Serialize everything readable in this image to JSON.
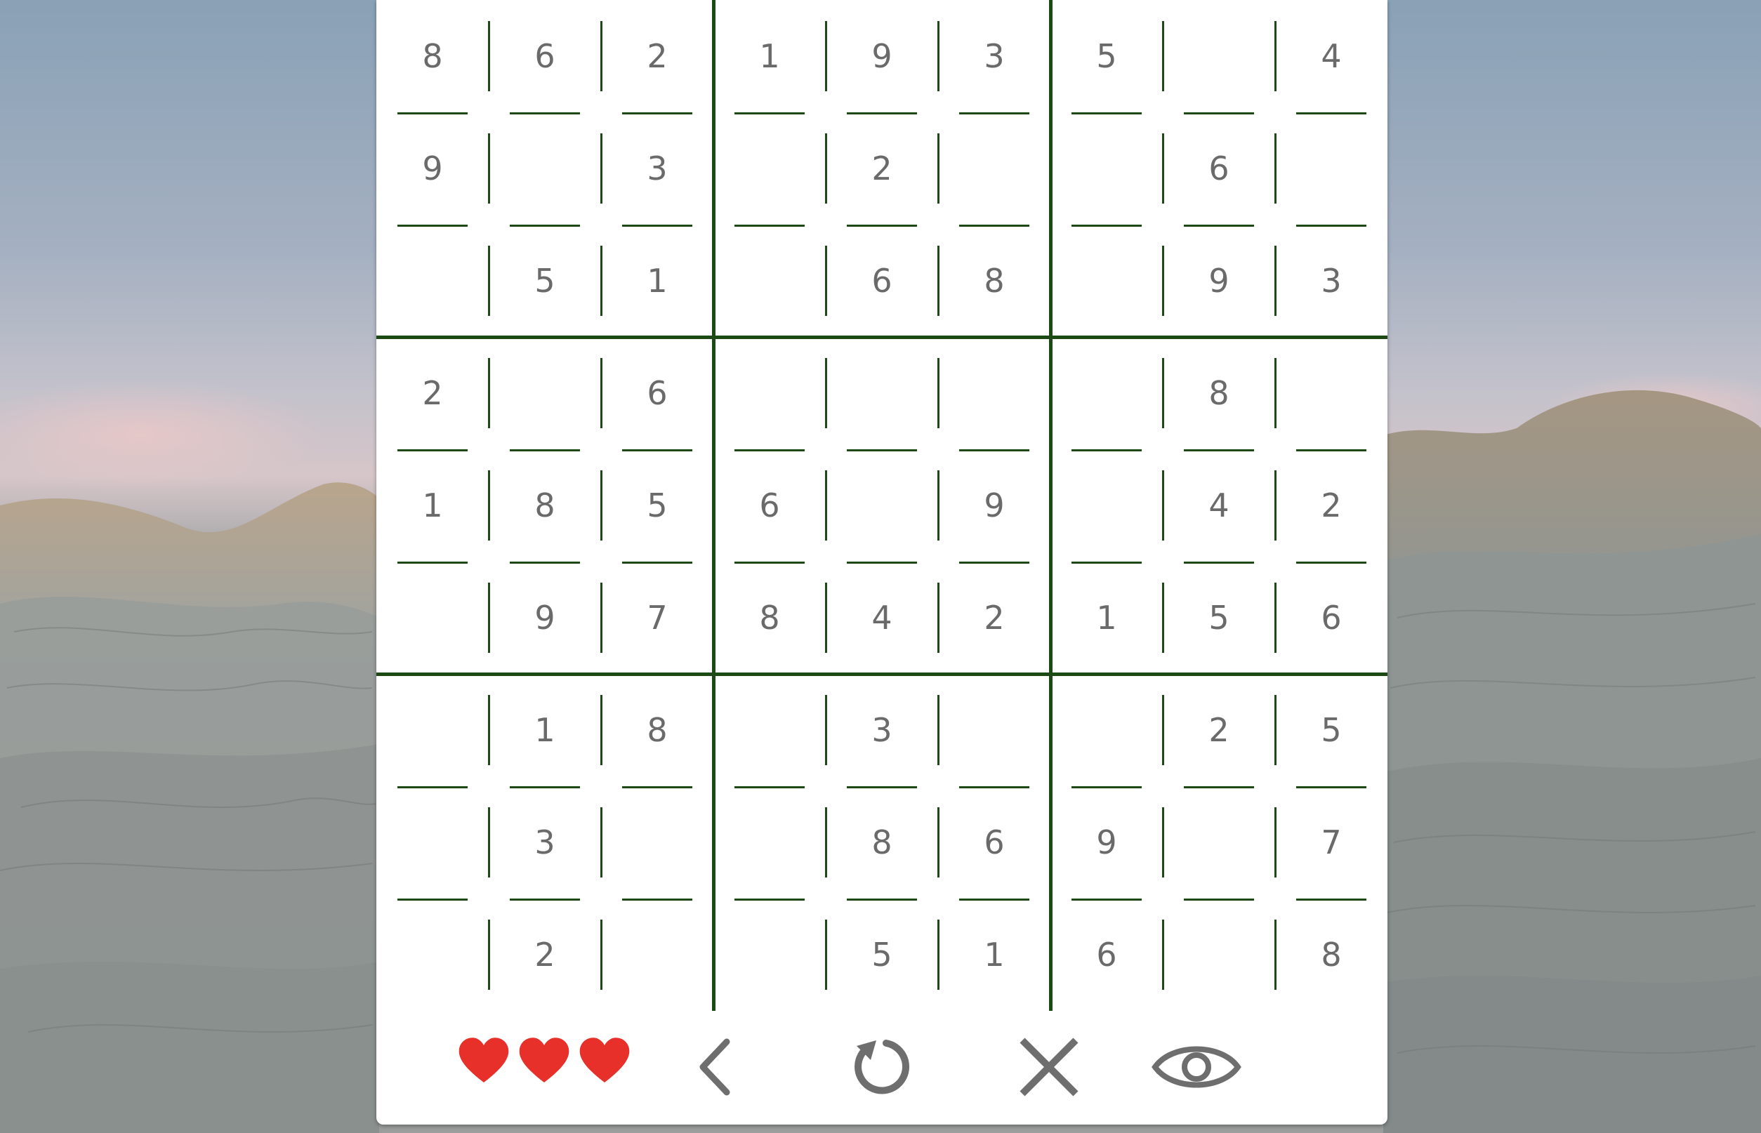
{
  "board": {
    "rows": [
      [
        "8",
        "6",
        "2",
        "1",
        "9",
        "3",
        "5",
        "",
        "4"
      ],
      [
        "9",
        "",
        "3",
        "",
        "2",
        "",
        "",
        "6",
        ""
      ],
      [
        "",
        "5",
        "1",
        "",
        "6",
        "8",
        "",
        "9",
        "3"
      ],
      [
        "2",
        "",
        "6",
        "",
        "",
        "",
        "",
        "8",
        ""
      ],
      [
        "1",
        "8",
        "5",
        "6",
        "",
        "9",
        "",
        "4",
        "2"
      ],
      [
        "",
        "9",
        "7",
        "8",
        "4",
        "2",
        "1",
        "5",
        "6"
      ],
      [
        "",
        "1",
        "8",
        "",
        "3",
        "",
        "",
        "2",
        "5"
      ],
      [
        "",
        "3",
        "",
        "",
        "8",
        "6",
        "9",
        "",
        "7"
      ],
      [
        "",
        "2",
        "",
        "",
        "5",
        "1",
        "6",
        "",
        "8"
      ]
    ]
  },
  "toolbar": {
    "lives": 3,
    "icons": [
      "heart-icon",
      "back-chevron-icon",
      "restart-icon",
      "close-icon",
      "eye-icon"
    ]
  },
  "colors": {
    "grid_lines": "#1d4a14",
    "digits": "#6a6a6a",
    "hearts": "#e8302a",
    "icons": "#6e6e6e",
    "window_background": "#ffffff"
  }
}
